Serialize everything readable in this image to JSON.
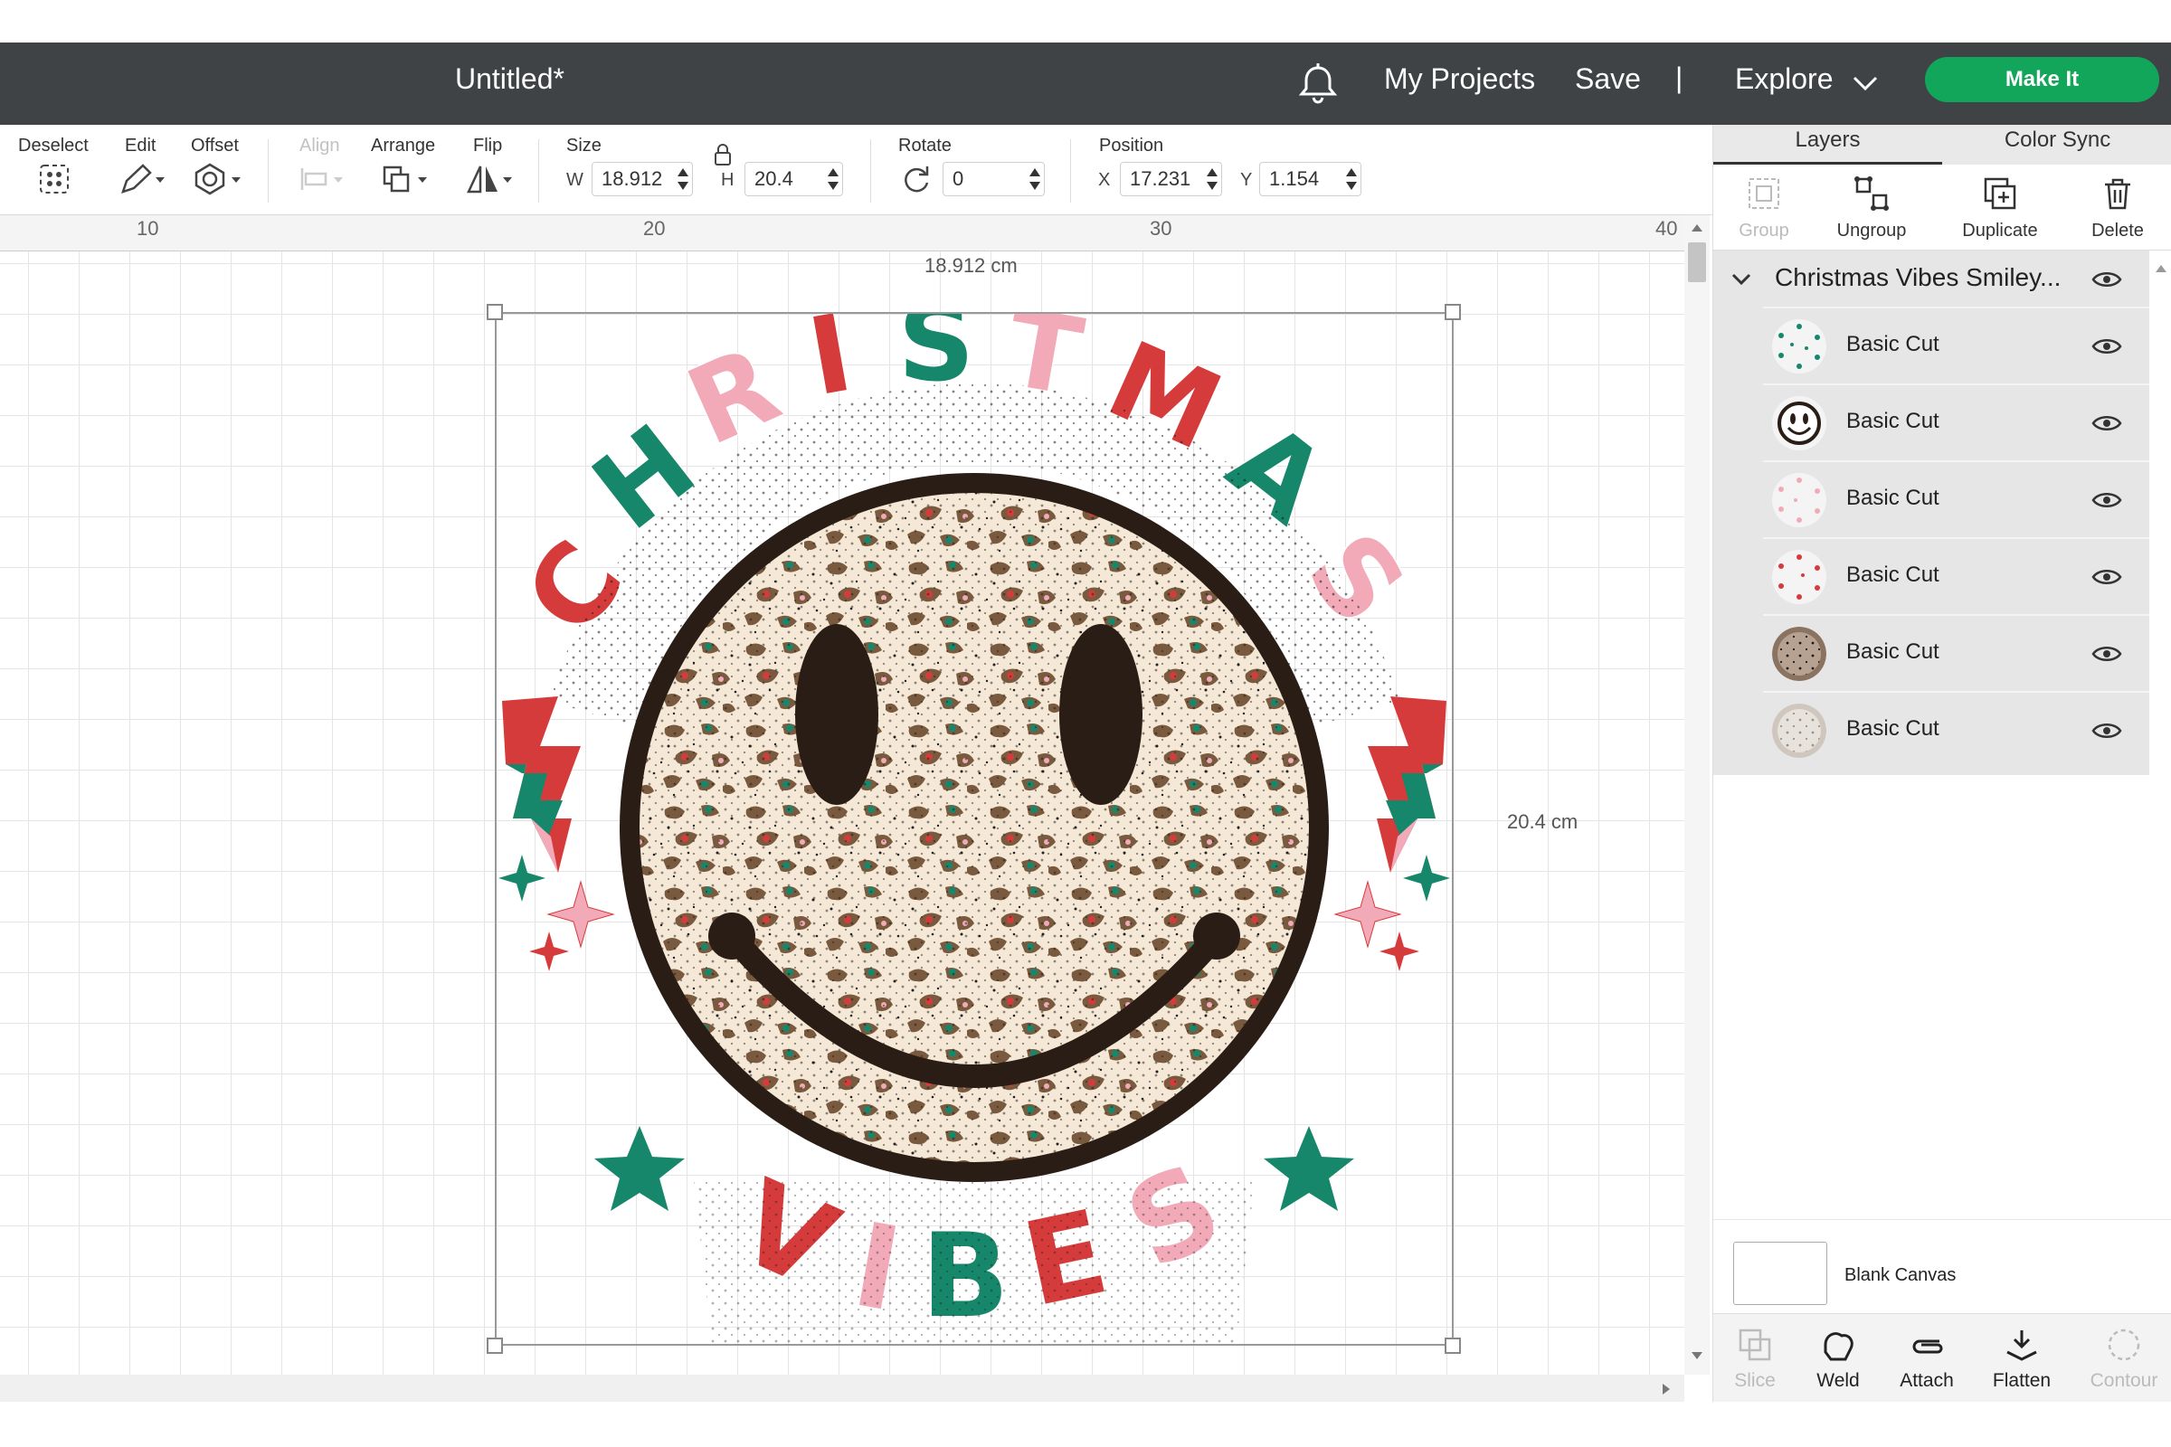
{
  "header": {
    "title": "Untitled*",
    "my_projects": "My Projects",
    "save": "Save",
    "separator": "|",
    "explore": "Explore",
    "make_it": "Make It",
    "accent_color": "#12a65b",
    "bar_color": "#3f4346"
  },
  "toolbar": {
    "deselect": "Deselect",
    "edit": "Edit",
    "offset": "Offset",
    "align": "Align",
    "arrange": "Arrange",
    "flip": "Flip",
    "size": "Size",
    "w_label": "W",
    "w_value": "18.912",
    "h_label": "H",
    "h_value": "20.4",
    "rotate": "Rotate",
    "rotate_value": "0",
    "position": "Position",
    "x_label": "X",
    "x_value": "17.231",
    "y_label": "Y",
    "y_value": "1.154"
  },
  "ruler": {
    "marks": [
      "10",
      "20",
      "30",
      "40"
    ]
  },
  "canvas": {
    "width_dim": "18.912 cm",
    "height_dim": "20.4 cm",
    "art_top_text": "CHRISTMAS",
    "art_bottom_text": "VIBES"
  },
  "panel": {
    "tabs": [
      "Layers",
      "Color Sync"
    ],
    "tools": [
      "Group",
      "Ungroup",
      "Duplicate",
      "Delete"
    ],
    "group_name": "Christmas Vibes Smiley...",
    "layers": [
      "Basic Cut",
      "Basic Cut",
      "Basic Cut",
      "Basic Cut",
      "Basic Cut",
      "Basic Cut"
    ],
    "blank_canvas": "Blank Canvas",
    "bottom_tools": [
      "Slice",
      "Weld",
      "Attach",
      "Flatten",
      "Contour"
    ]
  },
  "colors": {
    "red": "#d63b3b",
    "green": "#16876a",
    "pink": "#f2aab8",
    "dark": "#2a1d16"
  }
}
